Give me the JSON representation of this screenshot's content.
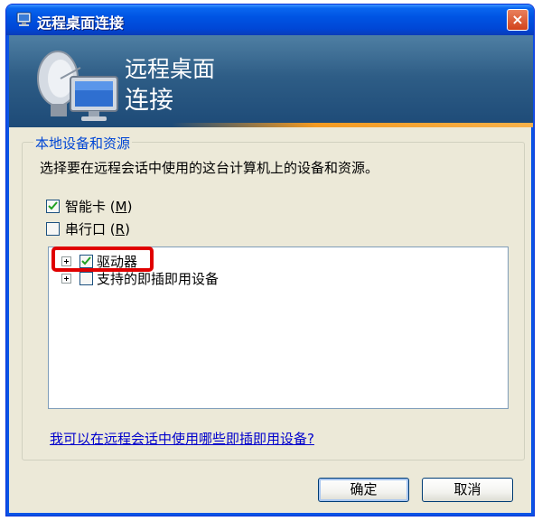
{
  "window": {
    "title": "远程桌面连接",
    "close_label": "×"
  },
  "banner": {
    "line1": "远程桌面",
    "line2": "连接"
  },
  "group": {
    "legend": "本地设备和资源",
    "description": "选择要在远程会话中使用的这台计算机上的设备和资源。"
  },
  "checks": {
    "smartcard": {
      "label": "智能卡 (M)",
      "label_main": "智能卡 (",
      "accel": "M",
      "label_end": ")",
      "checked": true
    },
    "serial": {
      "label": "串行口 (R)",
      "label_main": "串行口 (",
      "accel": "R",
      "label_end": ")",
      "checked": false
    }
  },
  "tree": {
    "items": [
      {
        "label": "驱动器",
        "checked": true,
        "icon": "expand-plus-icon"
      },
      {
        "label": "支持的即插即用设备",
        "checked": false,
        "icon": "expand-plus-icon"
      }
    ]
  },
  "help_link": "我可以在远程会话中使用哪些即插即用设备?",
  "buttons": {
    "ok": "确定",
    "cancel": "取消"
  },
  "colors": {
    "titlebar": "#0054e3",
    "banner": "#2e5d86",
    "accent_stripe": "#f39a21",
    "legend_text": "#0046d5",
    "highlight": "#e00000"
  }
}
